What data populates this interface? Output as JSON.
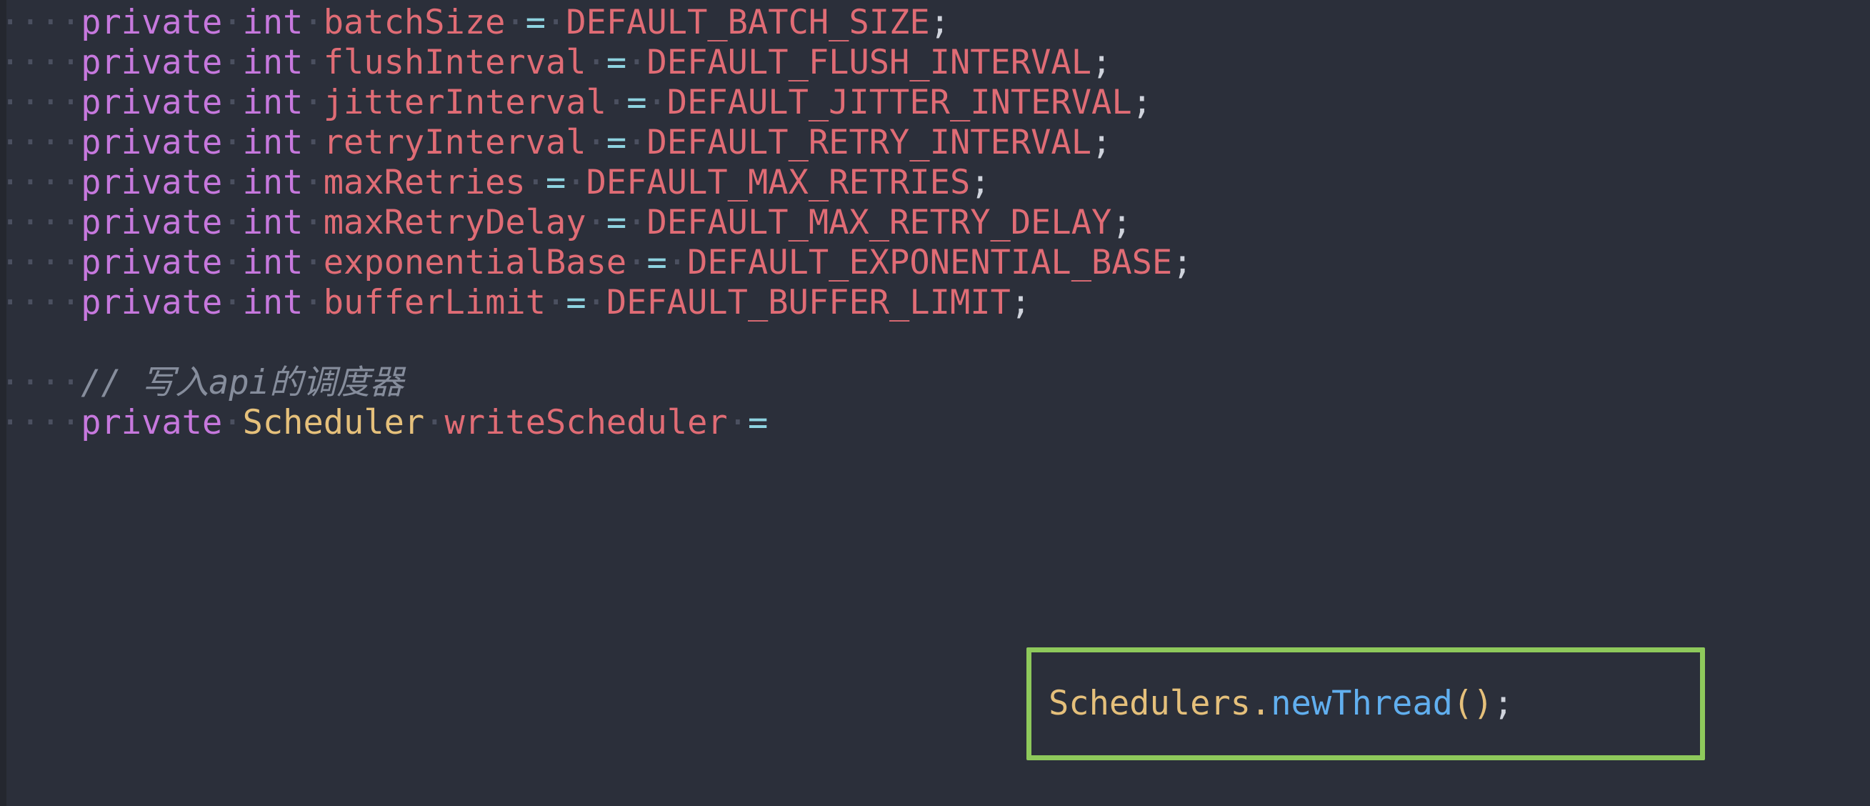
{
  "editor": {
    "background_color": "#2b2f3a",
    "font_size_px": 47,
    "line_height_px": 56,
    "language": "java",
    "indent_dot": "·",
    "space_dot": "·",
    "indent_level_text": "····"
  },
  "theme": {
    "keyword_color": "#c678dd",
    "identifier_color": "#e06c75",
    "operator_color": "#8ed3e0",
    "punctuation_color": "#cfd3dc",
    "type_color": "#e5c07b",
    "method_color": "#61afef",
    "comment_color": "#868d9c",
    "whitespace_dot_color": "#4b5060",
    "highlight_border_color": "#8ec95b"
  },
  "code_lines": [
    {
      "indent": "····",
      "keyword1": "private",
      "keyword2": "int",
      "field": "batchSize",
      "operator": "=",
      "constant": "DEFAULT_BATCH_SIZE",
      "terminator": ";"
    },
    {
      "indent": "····",
      "keyword1": "private",
      "keyword2": "int",
      "field": "flushInterval",
      "operator": "=",
      "constant": "DEFAULT_FLUSH_INTERVAL",
      "terminator": ";"
    },
    {
      "indent": "····",
      "keyword1": "private",
      "keyword2": "int",
      "field": "jitterInterval",
      "operator": "=",
      "constant": "DEFAULT_JITTER_INTERVAL",
      "terminator": ";"
    },
    {
      "indent": "····",
      "keyword1": "private",
      "keyword2": "int",
      "field": "retryInterval",
      "operator": "=",
      "constant": "DEFAULT_RETRY_INTERVAL",
      "terminator": ";"
    },
    {
      "indent": "····",
      "keyword1": "private",
      "keyword2": "int",
      "field": "maxRetries",
      "operator": "=",
      "constant": "DEFAULT_MAX_RETRIES",
      "terminator": ";"
    },
    {
      "indent": "····",
      "keyword1": "private",
      "keyword2": "int",
      "field": "maxRetryDelay",
      "operator": "=",
      "constant": "DEFAULT_MAX_RETRY_DELAY",
      "terminator": ";"
    },
    {
      "indent": "····",
      "keyword1": "private",
      "keyword2": "int",
      "field": "exponentialBase",
      "operator": "=",
      "constant": "DEFAULT_EXPONENTIAL_BASE",
      "terminator": ";"
    },
    {
      "indent": "····",
      "keyword1": "private",
      "keyword2": "int",
      "field": "bufferLimit",
      "operator": "=",
      "constant": "DEFAULT_BUFFER_LIMIT",
      "terminator": ";"
    }
  ],
  "comment_line": {
    "indent": "····",
    "text": "// 写入api的调度器"
  },
  "declaration_line": {
    "indent": "····",
    "keyword": "private",
    "type": "Scheduler",
    "field": "writeScheduler",
    "operator": "="
  },
  "highlighted_expression": {
    "class_name": "Schedulers",
    "dot": ".",
    "method": "newThread",
    "parens": "()",
    "terminator": ";"
  }
}
